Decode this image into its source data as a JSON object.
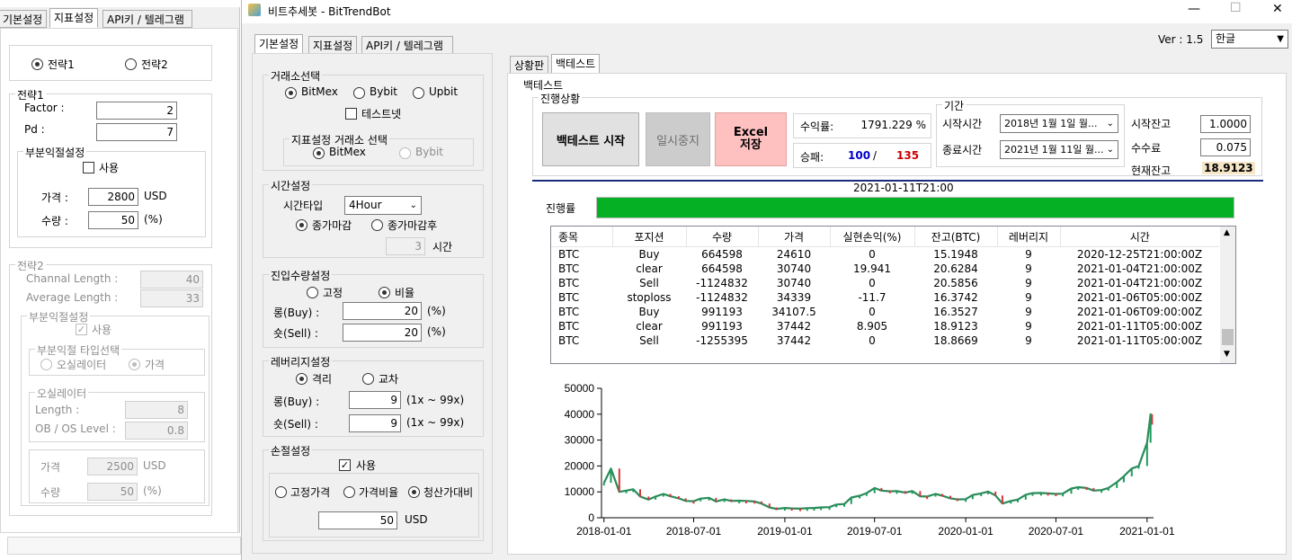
{
  "window": {
    "title": "비트추세봇 - BitTrendBot",
    "version_label": "Ver : 1.5",
    "language": "한글",
    "controls": {
      "minimize": "—",
      "maximize": "☐",
      "close": "✕"
    }
  },
  "bg_window": {
    "tabs": [
      "기본설정",
      "지표설정",
      "API키 / 텔레그램"
    ],
    "strategy_select": {
      "opt1": "전략1",
      "opt2": "전략2"
    },
    "strategy1": {
      "title": "전략1",
      "factor_label": "Factor :",
      "factor": "2",
      "pd_label": "Pd :",
      "pd": "7",
      "partial": {
        "title": "부분익절설정",
        "use_label": "사용",
        "price_label": "가격 :",
        "price": "2800",
        "price_unit": "USD",
        "qty_label": "수량 :",
        "qty": "50",
        "qty_unit": "(%)"
      }
    },
    "strategy2": {
      "title": "전략2",
      "channel_label": "Channal Length :",
      "channel": "40",
      "avg_label": "Average Length :",
      "avg": "33",
      "partial_title": "부분익절설정",
      "use_label": "사용",
      "type_title": "부분익절 타입선택",
      "type_opt1": "오실레이터",
      "type_opt2": "가격",
      "osc_title": "오실레이터",
      "length_label": "Length :",
      "length": "8",
      "obos_label": "OB / OS Level :",
      "obos": "0.8",
      "price_label": "가격",
      "price": "2500",
      "price_unit": "USD",
      "qty_label": "수량",
      "qty": "50",
      "qty_unit": "(%)"
    }
  },
  "settings": {
    "tabs": [
      "기본설정",
      "지표설정",
      "API키 / 텔레그램"
    ],
    "exchange": {
      "title": "거래소선택",
      "opt1": "BitMex",
      "opt2": "Bybit",
      "opt3": "Upbit",
      "testnet_label": "테스트넷",
      "ind_title": "지표설정 거래소 선택",
      "ind_opt1": "BitMex",
      "ind_opt2": "Bybit"
    },
    "time": {
      "title": "시간설정",
      "type_label": "시간타입",
      "type_value": "4Hour",
      "opt1": "종가마감",
      "opt2": "종가마감후",
      "hours": "3",
      "hours_unit": "시간"
    },
    "entry": {
      "title": "진입수량설정",
      "opt1": "고정",
      "opt2": "비율",
      "long_label": "롱(Buy) :",
      "long": "20",
      "short_label": "숏(Sell) :",
      "short": "20",
      "unit": "(%)"
    },
    "leverage": {
      "title": "레버리지설정",
      "opt1": "격리",
      "opt2": "교차",
      "long_label": "롱(Buy) :",
      "long": "9",
      "short_label": "숏(Sell) :",
      "short": "9",
      "range": "(1x ~ 99x)"
    },
    "stoploss": {
      "title": "손절설정",
      "use_label": "사용",
      "opt1": "고정가격",
      "opt2": "가격비율",
      "opt3": "청산가대비",
      "value": "50",
      "unit": "USD"
    }
  },
  "right": {
    "tabs": [
      "상황판",
      "백테스트"
    ],
    "backtest_title": "백테스트",
    "progress_title": "진행상황",
    "start_button": "백테스트 시작",
    "pause_button": "일시중지",
    "excel_button": "Excel\n저장",
    "return_label": "수익률:",
    "return_value": "1791.229 %",
    "winrate_label": "승패:",
    "wins": "100",
    "slash": "/",
    "losses": "135",
    "period_title": "기간",
    "start_label": "시작시간",
    "start_value": "2018년   1월   1일 월...",
    "end_label": "종료시간",
    "end_value": "2021년   1월 11일 월...",
    "start_bal_label": "시작잔고",
    "start_bal": "1.0000",
    "fee_label": "수수료",
    "fee": "0.075",
    "cur_bal_label": "현재잔고",
    "cur_bal": "18.9123",
    "current_time": "2021-01-11T21:00",
    "progress_label": "진행률",
    "progress": 1.0,
    "colors": {
      "progress": "#06b025",
      "wins": "#0000cc",
      "losses": "#cc0000",
      "excel_bg": "#ffc0c0",
      "cur_bal_bg": "#f5e6c8"
    }
  },
  "trades": {
    "columns": [
      "종목",
      "포지션",
      "수량",
      "가격",
      "실현손익(%)",
      "잔고(BTC)",
      "레버리지",
      "시간"
    ],
    "rows": [
      [
        "BTC",
        "Buy",
        "664598",
        "24610",
        "0",
        "15.1948",
        "9",
        "2020-12-25T21:00:00Z"
      ],
      [
        "BTC",
        "clear",
        "664598",
        "30740",
        "19.941",
        "20.6284",
        "9",
        "2021-01-04T21:00:00Z"
      ],
      [
        "BTC",
        "Sell",
        "-1124832",
        "30740",
        "0",
        "20.5856",
        "9",
        "2021-01-04T21:00:00Z"
      ],
      [
        "BTC",
        "stoploss",
        "-1124832",
        "34339",
        "-11.7",
        "16.3742",
        "9",
        "2021-01-06T05:00:00Z"
      ],
      [
        "BTC",
        "Buy",
        "991193",
        "34107.5",
        "0",
        "16.3527",
        "9",
        "2021-01-06T09:00:00Z"
      ],
      [
        "BTC",
        "clear",
        "991193",
        "37442",
        "8.905",
        "18.9123",
        "9",
        "2021-01-11T05:00:00Z"
      ],
      [
        "BTC",
        "Sell",
        "-1255395",
        "37442",
        "0",
        "18.8669",
        "9",
        "2021-01-11T05:00:00Z"
      ]
    ]
  },
  "chart_data": {
    "type": "line",
    "title": "",
    "xlabel": "",
    "ylabel": "",
    "x_ticks": [
      "2018-01-01",
      "2018-07-01",
      "2019-01-01",
      "2019-07-01",
      "2020-01-01",
      "2020-07-01",
      "2021-01-01"
    ],
    "y_ticks": [
      "0",
      "10000",
      "20000",
      "30000",
      "40000",
      "50000"
    ],
    "ylim": [
      0,
      50000
    ],
    "x": [
      "2018-01-01",
      "2018-01-15",
      "2018-02-01",
      "2018-02-15",
      "2018-03-01",
      "2018-03-15",
      "2018-04-01",
      "2018-04-15",
      "2018-05-01",
      "2018-05-15",
      "2018-06-01",
      "2018-06-15",
      "2018-07-01",
      "2018-07-15",
      "2018-08-01",
      "2018-08-15",
      "2018-09-01",
      "2018-09-15",
      "2018-10-01",
      "2018-10-15",
      "2018-11-01",
      "2018-11-15",
      "2018-12-01",
      "2018-12-15",
      "2019-01-01",
      "2019-01-15",
      "2019-02-01",
      "2019-02-15",
      "2019-03-01",
      "2019-03-15",
      "2019-04-01",
      "2019-04-15",
      "2019-05-01",
      "2019-05-15",
      "2019-06-01",
      "2019-06-15",
      "2019-07-01",
      "2019-07-15",
      "2019-08-01",
      "2019-08-15",
      "2019-09-01",
      "2019-09-15",
      "2019-10-01",
      "2019-10-15",
      "2019-11-01",
      "2019-11-15",
      "2019-12-01",
      "2019-12-15",
      "2020-01-01",
      "2020-01-15",
      "2020-02-01",
      "2020-02-15",
      "2020-03-01",
      "2020-03-15",
      "2020-04-01",
      "2020-04-15",
      "2020-05-01",
      "2020-05-15",
      "2020-06-01",
      "2020-06-15",
      "2020-07-01",
      "2020-07-15",
      "2020-08-01",
      "2020-08-15",
      "2020-09-01",
      "2020-09-15",
      "2020-10-01",
      "2020-10-15",
      "2020-11-01",
      "2020-11-15",
      "2020-12-01",
      "2020-12-15",
      "2021-01-01",
      "2021-01-08",
      "2021-01-11"
    ],
    "series": [
      {
        "values": [
          13500,
          19000,
          10000,
          10500,
          11000,
          8200,
          7000,
          8200,
          9200,
          8300,
          7500,
          6500,
          6400,
          7400,
          7700,
          6300,
          7100,
          6500,
          6600,
          6500,
          6300,
          5500,
          4000,
          3400,
          3800,
          3600,
          3500,
          3700,
          3800,
          4000,
          4100,
          5100,
          5300,
          7800,
          8500,
          9500,
          11500,
          10500,
          10200,
          10300,
          9700,
          10300,
          8300,
          8200,
          9200,
          8500,
          7500,
          7100,
          7200,
          8800,
          9400,
          10100,
          8600,
          5500,
          6500,
          7000,
          8900,
          9500,
          9600,
          9400,
          9200,
          9300,
          11300,
          11800,
          11500,
          10500,
          10700,
          11500,
          13700,
          16000,
          19000,
          20000,
          29000,
          40000,
          36000
        ]
      }
    ]
  }
}
